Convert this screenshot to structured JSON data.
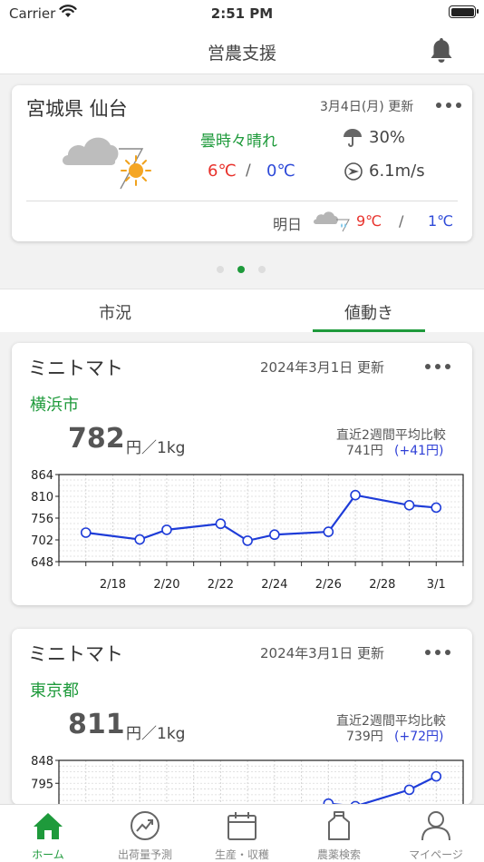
{
  "status_bar": {
    "carrier": "Carrier",
    "time": "2:51 PM"
  },
  "nav": {
    "title": "営農支援",
    "bell_icon": "bell-icon"
  },
  "weather": {
    "location": "宮城県 仙台",
    "updated": "3月4日(月) 更新",
    "condition": "曇時々晴れ",
    "high": "6℃",
    "separator": "/",
    "low": "0℃",
    "rain": "30%",
    "wind": "6.1m/s",
    "tomorrow_label": "明日",
    "tomorrow_high": "9℃",
    "tomorrow_low": "1℃",
    "icons": [
      "cloud-sun-icon",
      "umbrella-icon",
      "wind-direction-icon",
      "cloud-rain-icon"
    ]
  },
  "pager": {
    "count": 3,
    "active": 1
  },
  "tabs": [
    {
      "label": "市況",
      "selected": false
    },
    {
      "label": "値動き",
      "selected": true
    }
  ],
  "cards": [
    {
      "name": "ミニトマト",
      "date": "2024年3月1日 更新",
      "city": "横浜市",
      "price": "782",
      "unit": "円／1kg",
      "compare_label": "直近2週間平均比較",
      "avg": "741円",
      "diff": "(+41円)"
    },
    {
      "name": "ミニトマト",
      "date": "2024年3月1日 更新",
      "city": "東京都",
      "price": "811",
      "unit": "円／1kg",
      "compare_label": "直近2週間平均比較",
      "avg": "739円",
      "diff": "(+72円)"
    }
  ],
  "chart_data": [
    {
      "type": "line",
      "y_ticks": [
        "864",
        "810",
        "756",
        "702",
        "648"
      ],
      "ylim": [
        648,
        864
      ],
      "x_ticks": [
        "2/18",
        "2/20",
        "2/22",
        "2/24",
        "2/26",
        "2/28",
        "3/1"
      ],
      "x": [
        "2/17",
        "2/19",
        "2/20",
        "2/22",
        "2/23",
        "2/24",
        "2/26",
        "2/27",
        "2/29",
        "3/1"
      ],
      "values": [
        720,
        703,
        727,
        742,
        700,
        715,
        722,
        813,
        788,
        782
      ],
      "grid": true
    },
    {
      "type": "line",
      "y_ticks": [
        "848",
        "795"
      ],
      "ylim": [
        636,
        848
      ],
      "x": [
        "2/26",
        "2/27",
        "2/29",
        "3/1"
      ],
      "values": [
        748,
        742,
        780,
        811
      ],
      "grid": true
    }
  ],
  "tabbar": [
    {
      "label": "ホーム",
      "icon": "home-icon",
      "active": true
    },
    {
      "label": "出荷量予測",
      "icon": "trend-up-icon",
      "active": false
    },
    {
      "label": "生産・収穫",
      "icon": "calendar-icon",
      "active": false
    },
    {
      "label": "農薬検索",
      "icon": "bottle-icon",
      "active": false
    },
    {
      "label": "マイページ",
      "icon": "person-icon",
      "active": false
    }
  ],
  "colors": {
    "accent": "#1e9a3b",
    "high": "#e8322c",
    "low": "#2e4ad8",
    "series": "#1e3cd8"
  }
}
